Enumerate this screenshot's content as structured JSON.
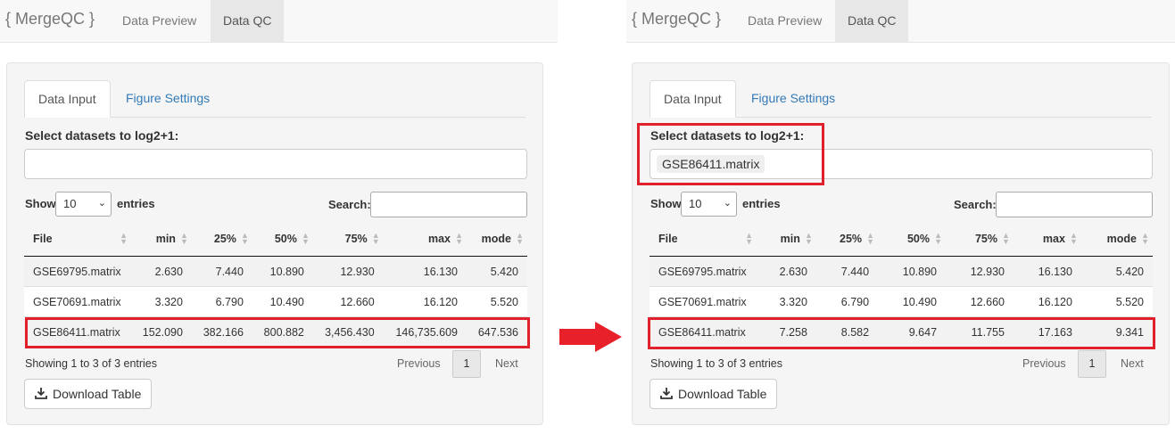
{
  "colors": {
    "highlight": "#e0202a",
    "link": "#337ab7",
    "arrow": "#e8202a"
  },
  "arrow_icon": "right-arrow",
  "panels": [
    {
      "brand": "{ MergeQC }",
      "nav": [
        "Data Preview",
        "Data QC"
      ],
      "tabs": [
        "Data Input",
        "Figure Settings"
      ],
      "select_label": "Select datasets to log2+1:",
      "selected_chip": "",
      "show_label": "Show",
      "page_length": "10",
      "entries_label": "entries",
      "search_label": "Search:",
      "columns": [
        "File",
        "min",
        "25%",
        "50%",
        "75%",
        "max",
        "mode"
      ],
      "rows": [
        [
          "GSE69795.matrix",
          "2.630",
          "7.440",
          "10.890",
          "12.930",
          "16.130",
          "5.420"
        ],
        [
          "GSE70691.matrix",
          "3.320",
          "6.790",
          "10.490",
          "12.660",
          "16.120",
          "5.520"
        ],
        [
          "GSE86411.matrix",
          "152.090",
          "382.166",
          "800.882",
          "3,456.430",
          "146,735.609",
          "647.536"
        ]
      ],
      "info": "Showing 1 to 3 of 3 entries",
      "pagination": {
        "previous": "Previous",
        "page": "1",
        "next": "Next"
      },
      "download_label": "Download Table"
    },
    {
      "brand": "{ MergeQC }",
      "nav": [
        "Data Preview",
        "Data QC"
      ],
      "tabs": [
        "Data Input",
        "Figure Settings"
      ],
      "select_label": "Select datasets to log2+1:",
      "selected_chip": "GSE86411.matrix",
      "show_label": "Show",
      "page_length": "10",
      "entries_label": "entries",
      "search_label": "Search:",
      "columns": [
        "File",
        "min",
        "25%",
        "50%",
        "75%",
        "max",
        "mode"
      ],
      "rows": [
        [
          "GSE69795.matrix",
          "2.630",
          "7.440",
          "10.890",
          "12.930",
          "16.130",
          "5.420"
        ],
        [
          "GSE70691.matrix",
          "3.320",
          "6.790",
          "10.490",
          "12.660",
          "16.120",
          "5.520"
        ],
        [
          "GSE86411.matrix",
          "7.258",
          "8.582",
          "9.647",
          "11.755",
          "17.163",
          "9.341"
        ]
      ],
      "info": "Showing 1 to 3 of 3 entries",
      "pagination": {
        "previous": "Previous",
        "page": "1",
        "next": "Next"
      },
      "download_label": "Download Table"
    }
  ]
}
